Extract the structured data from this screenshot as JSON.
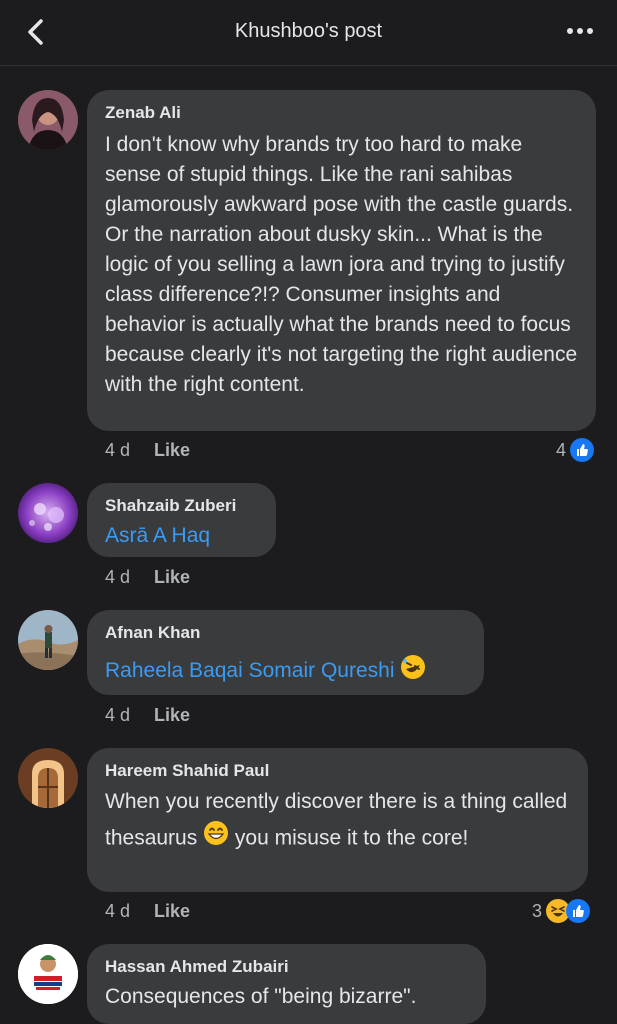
{
  "header": {
    "title": "Khushboo's post"
  },
  "comments": [
    {
      "author": "Zenab Ali",
      "text": "I don't know why brands try too hard to make sense of stupid things. Like the rani sahibas glamorously awkward pose with the castle guards. Or the narration about dusky skin... What is the logic of you selling a lawn jora and trying to justify class difference?!? Consumer insights and behavior is actually what the brands need to focus because clearly it's not targeting the right audience with the right content.",
      "time": "4 d",
      "like_label": "Like",
      "reaction_count": "4"
    },
    {
      "author": "Shahzaib Zuberi",
      "mention": "Asrā A Haq",
      "time": "4 d",
      "like_label": "Like"
    },
    {
      "author": "Afnan Khan",
      "mention": "Raheela Baqai Somair Qureshi",
      "time": "4 d",
      "like_label": "Like"
    },
    {
      "author": "Hareem Shahid Paul",
      "text_part1": "When you recently discover there is a thing called thesaurus",
      "text_part2": "you misuse it to the core!",
      "time": "4 d",
      "like_label": "Like",
      "reaction_count": "3"
    },
    {
      "author": "Hassan Ahmed Zubairi",
      "text": "Consequences of \"being bizarre\"."
    }
  ],
  "colors": {
    "background": "#1c1c1e",
    "bubble": "#3a3b3c",
    "mention": "#3a9bf5",
    "like_blue": "#1877f2",
    "meta_gray": "#b0b3b8"
  },
  "icons": {
    "back": "chevron-left-icon",
    "more": "more-horizontal-icon",
    "like_reaction": "thumbs-up-icon",
    "haha_reaction": "laughing-face-icon",
    "rofl_emoji": "rolling-laughing-emoji",
    "grin_emoji": "grinning-face-emoji"
  }
}
